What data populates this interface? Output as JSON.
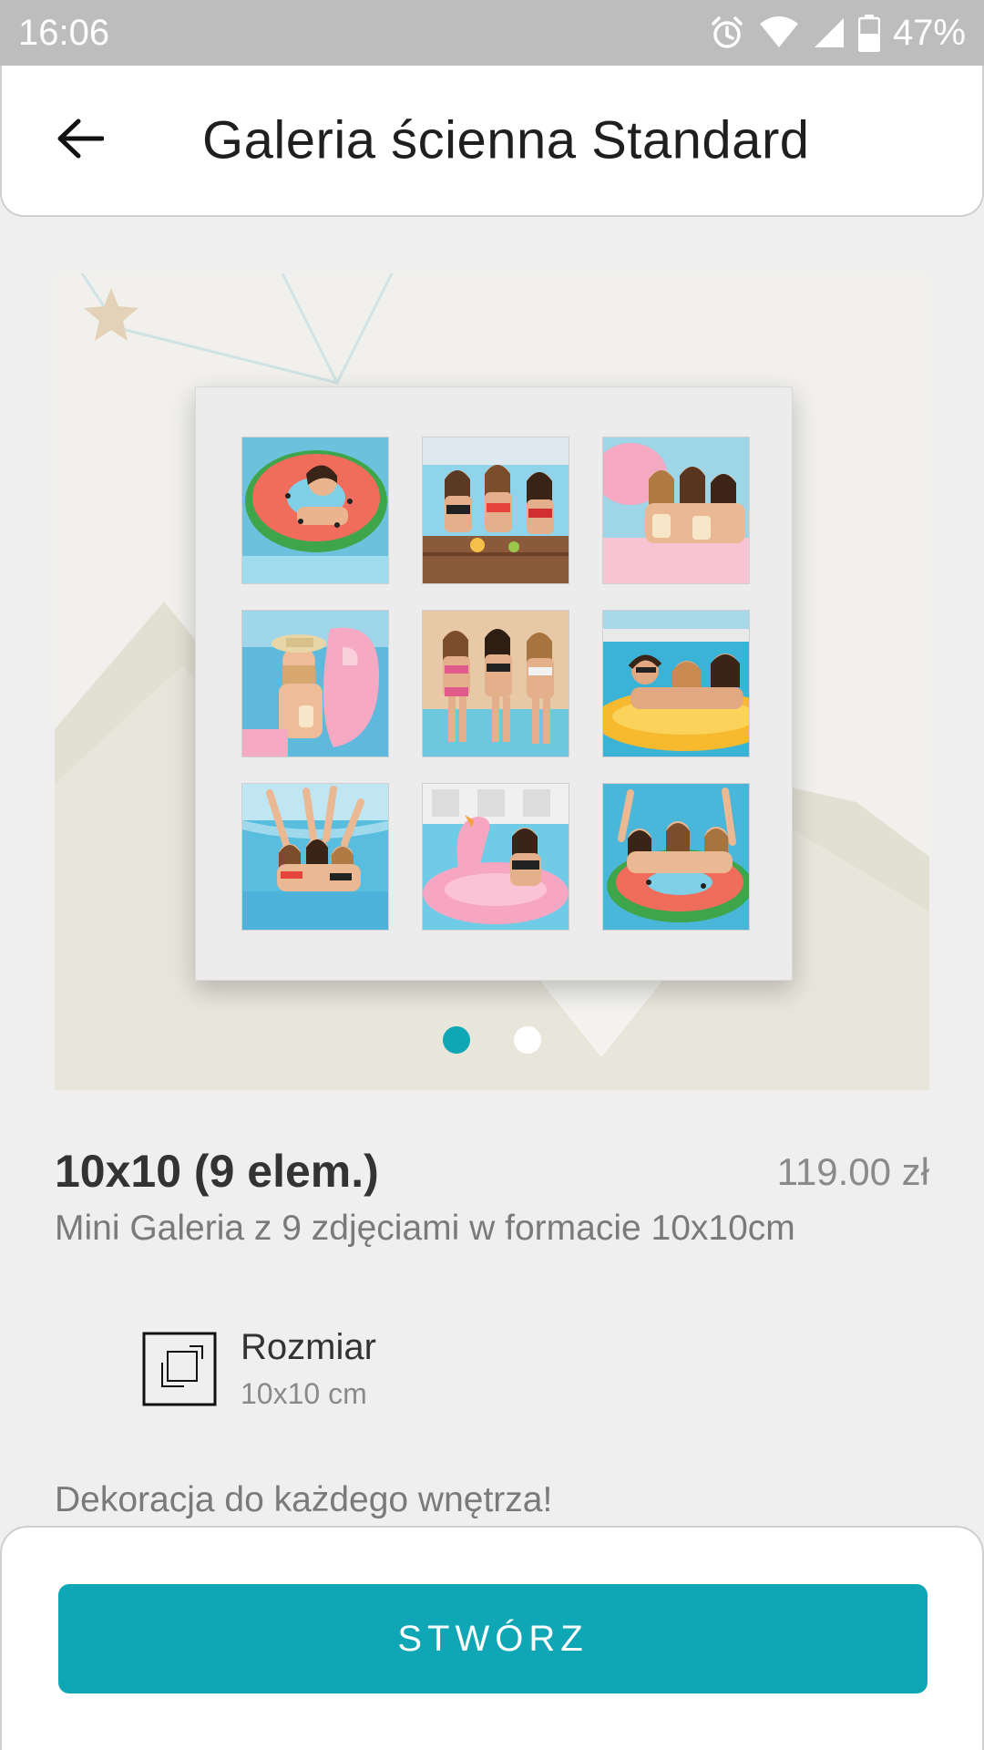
{
  "status_bar": {
    "time": "16:06",
    "battery": "47%",
    "icons": [
      "alarm-icon",
      "wifi-icon",
      "signal-icon",
      "battery-icon"
    ]
  },
  "header": {
    "back_icon": "arrow-left-icon",
    "title": "Galeria ścienna Standard"
  },
  "carousel": {
    "page_count": 2,
    "active_index": 0,
    "photo_icons": [
      "photo-1",
      "photo-2",
      "photo-3",
      "photo-4",
      "photo-5",
      "photo-6",
      "photo-7",
      "photo-8",
      "photo-9"
    ]
  },
  "product": {
    "name": "10x10 (9 elem.)",
    "price": "119.00 zł",
    "description": "Mini Galeria z 9 zdjęciami w formacie 10x10cm"
  },
  "size": {
    "icon": "size-frame-icon",
    "label": "Rozmiar",
    "value": "10x10 cm"
  },
  "tagline": "Dekoracja do każdego wnętrza!",
  "actions": {
    "create_label": "STWÓRZ"
  },
  "colors": {
    "accent": "#0fa7b5",
    "status_bar": "#bdbdbd",
    "background": "#efefef"
  }
}
